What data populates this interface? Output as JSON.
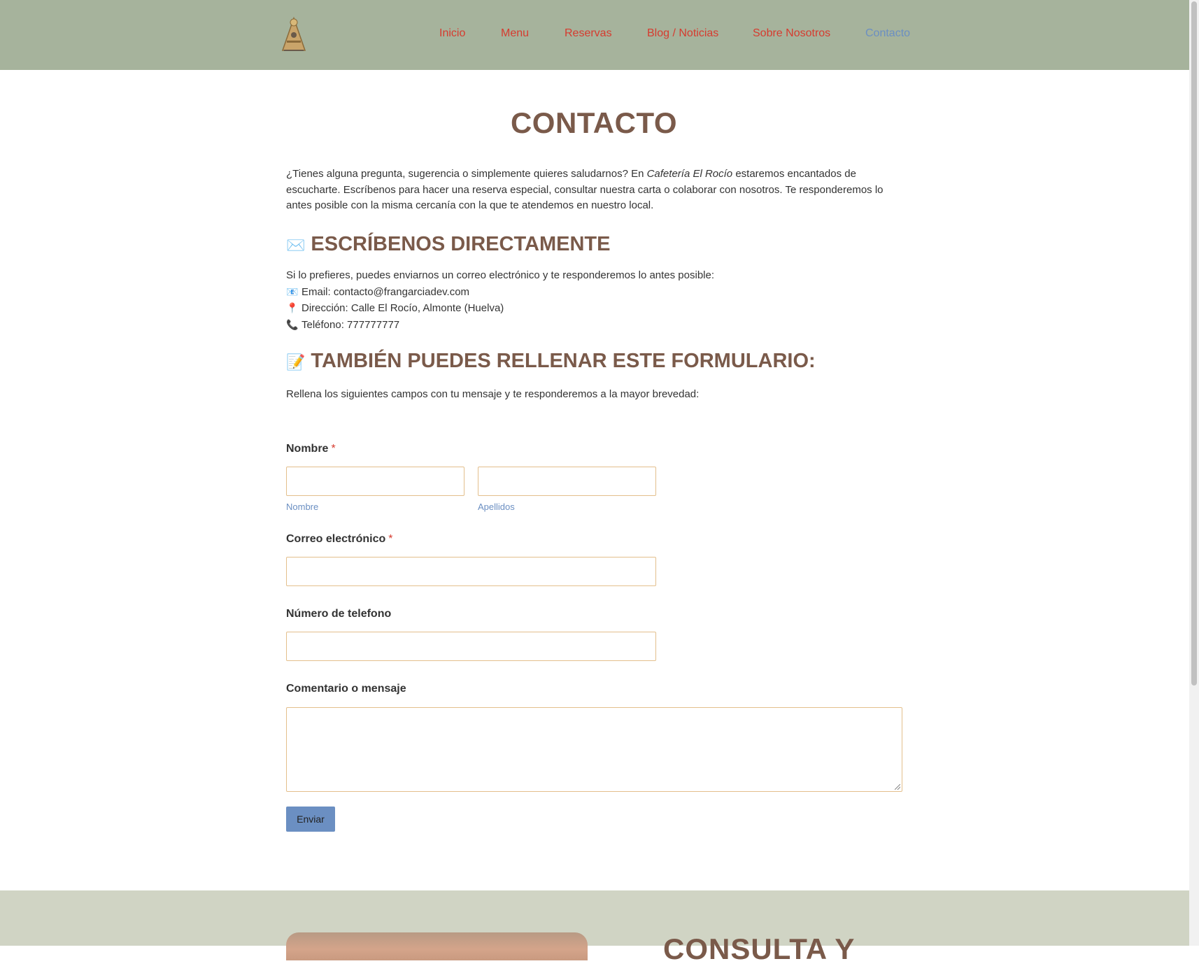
{
  "nav": {
    "items": [
      {
        "label": "Inicio"
      },
      {
        "label": "Menu"
      },
      {
        "label": "Reservas"
      },
      {
        "label": "Blog / Noticias"
      },
      {
        "label": "Sobre Nosotros"
      },
      {
        "label": "Contacto",
        "active": true
      }
    ]
  },
  "page": {
    "title": "CONTACTO",
    "intro_before": "¿Tienes alguna pregunta, sugerencia o simplemente quieres saludarnos? En ",
    "intro_italic": "Cafetería El Rocío",
    "intro_after": " estaremos encantados de escucharte. Escríbenos para hacer una reserva especial, consultar nuestra carta o colaborar con nosotros. Te responderemos lo antes posible con la misma cercanía con la que te atendemos en nuestro local."
  },
  "direct": {
    "emoji": "✉️",
    "heading": "ESCRÍBENOS DIRECTAMENTE",
    "lead": "Si lo prefieres, puedes enviarnos un correo electrónico y te responderemos lo antes posible:",
    "email_icon": "📧",
    "email": "Email: contacto@frangarciadev.com",
    "address_icon": "📍",
    "address": "Dirección:  Calle  El Rocío, Almonte (Huelva)",
    "phone_icon": "📞",
    "phone": "Teléfono: 777777777"
  },
  "form": {
    "emoji": "📝",
    "heading": "TAMBIÉN PUEDES RELLENAR ESTE FORMULARIO:",
    "intro": "Rellena los siguientes campos con tu mensaje y te responderemos a la mayor brevedad:",
    "name_label": "Nombre",
    "required_mark": "*",
    "first_sublabel": "Nombre",
    "last_sublabel": "Apellidos",
    "email_label": "Correo electrónico",
    "phone_label": "Número de telefono",
    "message_label": "Comentario o mensaje",
    "submit_label": "Enviar"
  },
  "footer": {
    "heading": "CONSULTA Y"
  },
  "colors": {
    "header_bg": "#a6b39c",
    "heading_brown": "#7a5a4a",
    "nav_red": "#d63b2f",
    "nav_active_blue": "#6b8fc2",
    "input_border": "#e3bf8c",
    "footer_bg": "#d0d4c4"
  }
}
